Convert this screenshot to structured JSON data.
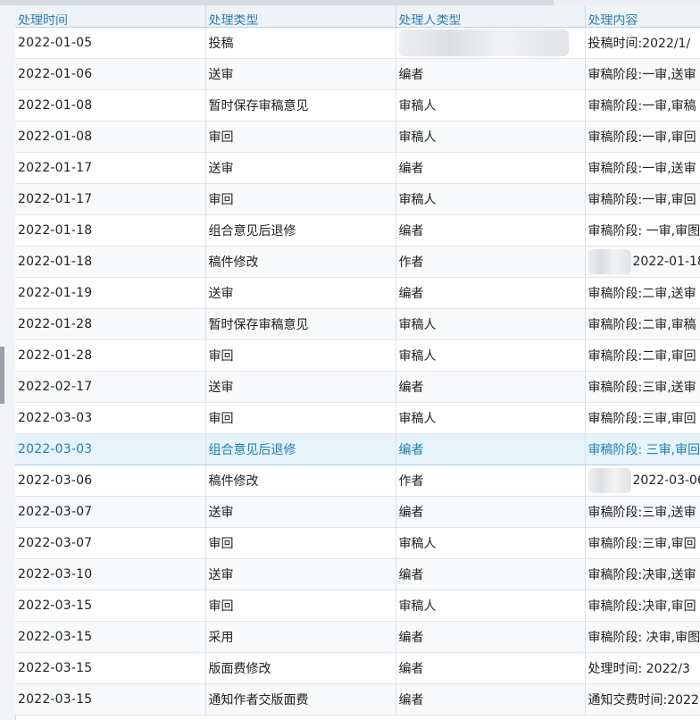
{
  "columns": [
    "处理时间",
    "处理类型",
    "处理人类型",
    "处理内容"
  ],
  "rows": [
    {
      "date": "2022-01-05",
      "type": "投稿",
      "role": "",
      "content": "投稿时间:2022/1/"
    },
    {
      "date": "2022-01-06",
      "type": "送审",
      "role": "编者",
      "content": "审稿阶段:一审,送审"
    },
    {
      "date": "2022-01-08",
      "type": "暂时保存审稿意见",
      "role": "审稿人",
      "content": "审稿阶段:一审,审稿"
    },
    {
      "date": "2022-01-08",
      "type": "审回",
      "role": "审稿人",
      "content": "审稿阶段:一审,审回"
    },
    {
      "date": "2022-01-17",
      "type": "送审",
      "role": "编者",
      "content": "审稿阶段:一审,送审"
    },
    {
      "date": "2022-01-17",
      "type": "审回",
      "role": "审稿人",
      "content": "审稿阶段:一审,审回"
    },
    {
      "date": "2022-01-18",
      "type": "组合意见后退修",
      "role": "编者",
      "content": "审稿阶段: 一审,审图"
    },
    {
      "date": "2022-01-18",
      "type": "稿件修改",
      "role": "作者",
      "content": "2022-01-18"
    },
    {
      "date": "2022-01-19",
      "type": "送审",
      "role": "编者",
      "content": "审稿阶段:二审,送审"
    },
    {
      "date": "2022-01-28",
      "type": "暂时保存审稿意见",
      "role": "审稿人",
      "content": "审稿阶段:二审,审稿"
    },
    {
      "date": "2022-01-28",
      "type": "审回",
      "role": "审稿人",
      "content": "审稿阶段:二审,审回"
    },
    {
      "date": "2022-02-17",
      "type": "送审",
      "role": "编者",
      "content": "审稿阶段:三审,送审"
    },
    {
      "date": "2022-03-03",
      "type": "审回",
      "role": "审稿人",
      "content": "审稿阶段:三审,审回"
    },
    {
      "date": "2022-03-03",
      "type": "组合意见后退修",
      "role": "编者",
      "content": "审稿阶段: 三审,审回"
    },
    {
      "date": "2022-03-06",
      "type": "稿件修改",
      "role": "作者",
      "content": "2022-03-06"
    },
    {
      "date": "2022-03-07",
      "type": "送审",
      "role": "编者",
      "content": "审稿阶段:三审,送审"
    },
    {
      "date": "2022-03-07",
      "type": "审回",
      "role": "审稿人",
      "content": "审稿阶段:三审,审回"
    },
    {
      "date": "2022-03-10",
      "type": "送审",
      "role": "编者",
      "content": "审稿阶段:决审,送审"
    },
    {
      "date": "2022-03-15",
      "type": "审回",
      "role": "审稿人",
      "content": "审稿阶段:决审,审回"
    },
    {
      "date": "2022-03-15",
      "type": "采用",
      "role": "编者",
      "content": "审稿阶段: 决审,审图"
    },
    {
      "date": "2022-03-15",
      "type": "版面费修改",
      "role": "编者",
      "content": "处理时间: 2022/3"
    },
    {
      "date": "2022-03-15",
      "type": "通知作者交版面费",
      "role": "编者",
      "content": "通知交费时间:2022"
    }
  ],
  "selected_row_index": 13,
  "blurred_cells": [
    {
      "row": 0,
      "col": 2
    },
    {
      "row": 7,
      "col": 3
    },
    {
      "row": 14,
      "col": 3
    }
  ],
  "colors": {
    "header_text": "#2f7fb2",
    "selected_bg": "#e6f3fb",
    "selected_text": "#1f7fb3"
  }
}
